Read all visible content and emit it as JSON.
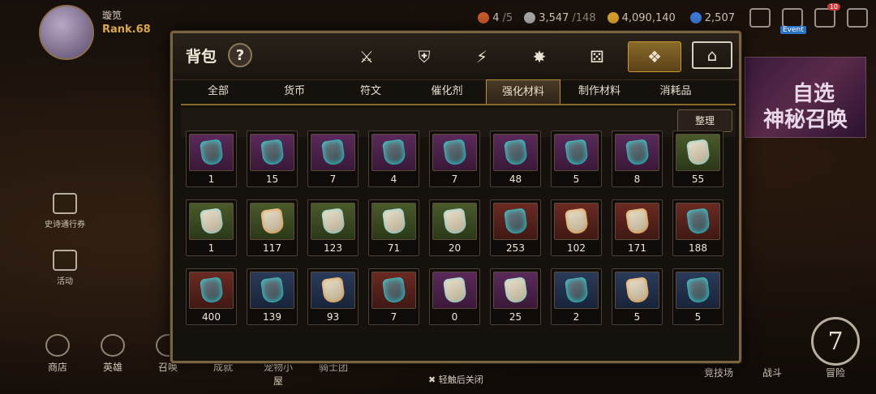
{
  "player": {
    "name": "璇笕",
    "rank": "Rank.68"
  },
  "resources": [
    {
      "icon": "sword-icon",
      "value": "4",
      "max": "/5",
      "color": "#c85a2a"
    },
    {
      "icon": "stamina-icon",
      "value": "3,547",
      "max": "/148",
      "color": "#a8a8a8"
    },
    {
      "icon": "gold-coin-icon",
      "value": "4,090,140",
      "max": "",
      "color": "#d8a02a"
    },
    {
      "icon": "crystal-icon",
      "value": "2,507",
      "max": "",
      "color": "#3a7ad8"
    }
  ],
  "top_icons": {
    "event_label": "Event",
    "badge": "10"
  },
  "side_menu": [
    {
      "label": "史诗通行券",
      "icon": "pass-icon"
    },
    {
      "label": "活动",
      "icon": "bell-icon"
    }
  ],
  "bottom_nav": [
    {
      "label": "商店",
      "icon": "scale-icon"
    },
    {
      "label": "英雄",
      "icon": "helmet-icon"
    },
    {
      "label": "召唤",
      "icon": "summon-icon"
    },
    {
      "label": "成就",
      "icon": "achievement-icon"
    },
    {
      "label": "宠物小屋",
      "icon": "pet-house-icon"
    },
    {
      "label": "骑士团",
      "icon": "knights-icon"
    }
  ],
  "bottom_right": [
    {
      "label": "竞技场"
    },
    {
      "label": "战斗"
    },
    {
      "label": "冒险",
      "number": "7"
    }
  ],
  "banner": {
    "line1": "自选",
    "line2": "神秘召唤"
  },
  "inventory": {
    "title": "背包",
    "help": "?",
    "category_tabs": [
      {
        "icon": "equipment-icon",
        "glyph": "⚔",
        "active": false
      },
      {
        "icon": "shield-broken-icon",
        "glyph": "⛨",
        "active": false
      },
      {
        "icon": "lightning-icon",
        "glyph": "⚡",
        "active": false
      },
      {
        "icon": "burst-icon",
        "glyph": "✸",
        "active": false
      },
      {
        "icon": "dice-icon",
        "glyph": "⚄",
        "active": false
      },
      {
        "icon": "items-icon",
        "glyph": "❖",
        "active": true
      },
      {
        "icon": "storage-icon",
        "glyph": "⌂",
        "active": false
      }
    ],
    "sub_tabs": [
      {
        "label": "全部",
        "active": false
      },
      {
        "label": "货币",
        "active": false
      },
      {
        "label": "符文",
        "active": false
      },
      {
        "label": "催化剂",
        "active": false
      },
      {
        "label": "强化材料",
        "active": true
      },
      {
        "label": "制作材料",
        "active": false
      },
      {
        "label": "消耗品",
        "active": false
      }
    ],
    "sort_label": "整理",
    "rows": [
      [
        {
          "qty": "1",
          "bg": "bg-purple",
          "art": "rune-cyan",
          "icon": "rune-icon"
        },
        {
          "qty": "15",
          "bg": "bg-purple",
          "art": "rune-cyan",
          "icon": "rune-icon"
        },
        {
          "qty": "7",
          "bg": "bg-purple",
          "art": "rune-cyan",
          "icon": "rune-icon"
        },
        {
          "qty": "4",
          "bg": "bg-purple",
          "art": "rune-cyan",
          "icon": "rune-icon"
        },
        {
          "qty": "7",
          "bg": "bg-purple",
          "art": "rune-cyan",
          "icon": "rune-icon"
        },
        {
          "qty": "48",
          "bg": "bg-purple",
          "art": "rune-cyan",
          "icon": "rune-icon"
        },
        {
          "qty": "5",
          "bg": "bg-purple",
          "art": "rune-cyan",
          "icon": "rune-icon"
        },
        {
          "qty": "8",
          "bg": "bg-purple",
          "art": "rune-cyan",
          "icon": "rune-icon"
        },
        {
          "qty": "55",
          "bg": "bg-green",
          "art": "rune-light",
          "icon": "rune-icon"
        }
      ],
      [
        {
          "qty": "1",
          "bg": "bg-green",
          "art": "rune-light",
          "icon": "rune-icon"
        },
        {
          "qty": "117",
          "bg": "bg-green",
          "art": "rune-light-gold",
          "icon": "rune-icon"
        },
        {
          "qty": "123",
          "bg": "bg-green",
          "art": "rune-light",
          "icon": "rune-icon"
        },
        {
          "qty": "71",
          "bg": "bg-green",
          "art": "rune-light",
          "icon": "rune-icon"
        },
        {
          "qty": "20",
          "bg": "bg-green",
          "art": "rune-light",
          "icon": "rune-icon"
        },
        {
          "qty": "253",
          "bg": "bg-red",
          "art": "rune-cyan",
          "icon": "feather-icon"
        },
        {
          "qty": "102",
          "bg": "bg-red",
          "art": "rune-light-gold",
          "icon": "crystal-ore-icon"
        },
        {
          "qty": "171",
          "bg": "bg-red",
          "art": "rune-light-gold",
          "icon": "ember-crystal-icon"
        },
        {
          "qty": "188",
          "bg": "bg-red",
          "art": "rune-cyan",
          "icon": "purple-crystal-icon"
        }
      ],
      [
        {
          "qty": "400",
          "bg": "bg-red",
          "art": "rune-cyan",
          "icon": "shard-icon"
        },
        {
          "qty": "139",
          "bg": "bg-blue",
          "art": "rune-cyan",
          "icon": "orb-icon"
        },
        {
          "qty": "93",
          "bg": "bg-blue",
          "art": "rune-light-gold",
          "icon": "plume-icon"
        },
        {
          "qty": "7",
          "bg": "bg-red",
          "art": "rune-cyan",
          "icon": "potion-icon"
        },
        {
          "qty": "0",
          "bg": "bg-purple",
          "art": "rune-light",
          "icon": "pet-card-icon"
        },
        {
          "qty": "25",
          "bg": "bg-purple",
          "art": "rune-light",
          "icon": "wand-icon"
        },
        {
          "qty": "2",
          "bg": "bg-blue",
          "art": "rune-cyan",
          "icon": "chest-icon"
        },
        {
          "qty": "5",
          "bg": "bg-blue",
          "art": "rune-light-gold",
          "icon": "chest-icon"
        },
        {
          "qty": "5",
          "bg": "bg-blue",
          "art": "rune-cyan",
          "icon": "chest-icon"
        }
      ]
    ],
    "close_hint": "✖ 轻触后关闭"
  }
}
